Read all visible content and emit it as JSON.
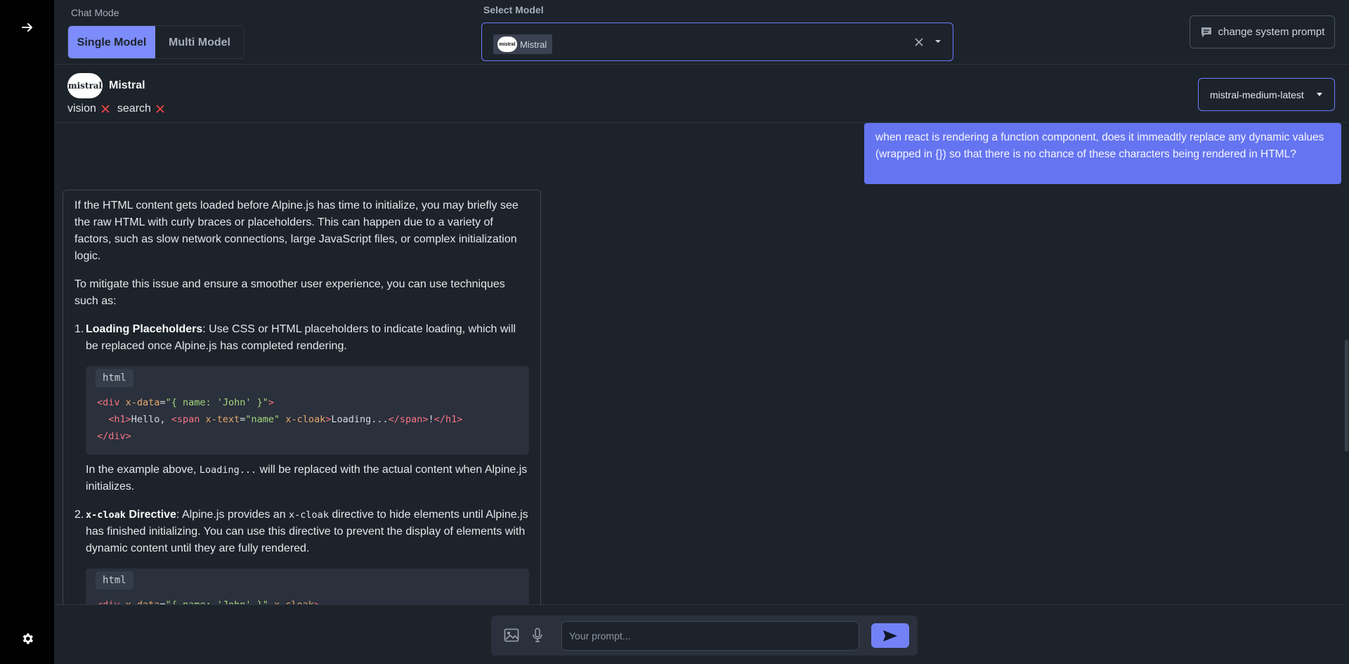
{
  "sidebar": {
    "expand_icon": "arrow-right-icon",
    "settings_icon": "gear-icon"
  },
  "topbar": {
    "chat_mode_label": "Chat Mode",
    "modes": [
      {
        "label": "Single Model",
        "active": true
      },
      {
        "label": "Multi Model",
        "active": false
      }
    ],
    "select_model_label": "Select Model",
    "selected_model_chip": "Mistral",
    "chip_logo_text": "mistral",
    "system_prompt_button": "change system prompt"
  },
  "model_header": {
    "logo_text": "mistral",
    "name": "Mistral",
    "capabilities": [
      {
        "label": "vision",
        "enabled": false
      },
      {
        "label": "search",
        "enabled": false
      }
    ],
    "variant": "mistral-medium-latest"
  },
  "chat": {
    "user_message": "when react is rendering a function component, does it immeadtly replace any dynamic values (wrapped in {}) so that there is no chance of these characters being rendered in HTML?",
    "assistant": {
      "p1": "If the HTML content gets loaded before Alpine.js has time to initialize, you may briefly see the raw HTML with curly braces or placeholders. This can happen due to a variety of factors, such as slow network connections, large JavaScript files, or complex initialization logic.",
      "p2": "To mitigate this issue and ensure a smoother user experience, you can use techniques such as:",
      "item1": {
        "num": "1.",
        "title": "Loading Placeholders",
        "text": ": Use CSS or HTML placeholders to indicate loading, which will be replaced once Alpine.js has completed rendering.",
        "code_lang": "html",
        "after_pre": "In the example above, ",
        "after_code": "Loading...",
        "after_post": " will be replaced with the actual content when Alpine.js initializes."
      },
      "item2": {
        "num": "2.",
        "title_code": "x-cloak",
        "title_rest": " Directive",
        "text_pre": ": Alpine.js provides an ",
        "text_code": "x-cloak",
        "text_post": " directive to hide elements until Alpine.js has finished initializing. You can use this directive to prevent the display of elements with dynamic content until they are fully rendered.",
        "code_lang": "html"
      }
    }
  },
  "composer": {
    "placeholder": "Your prompt..."
  },
  "colors": {
    "accent": "#7282f6",
    "user_bubble": "#6574f0",
    "background": "#1d232a",
    "rail": "#000000"
  }
}
